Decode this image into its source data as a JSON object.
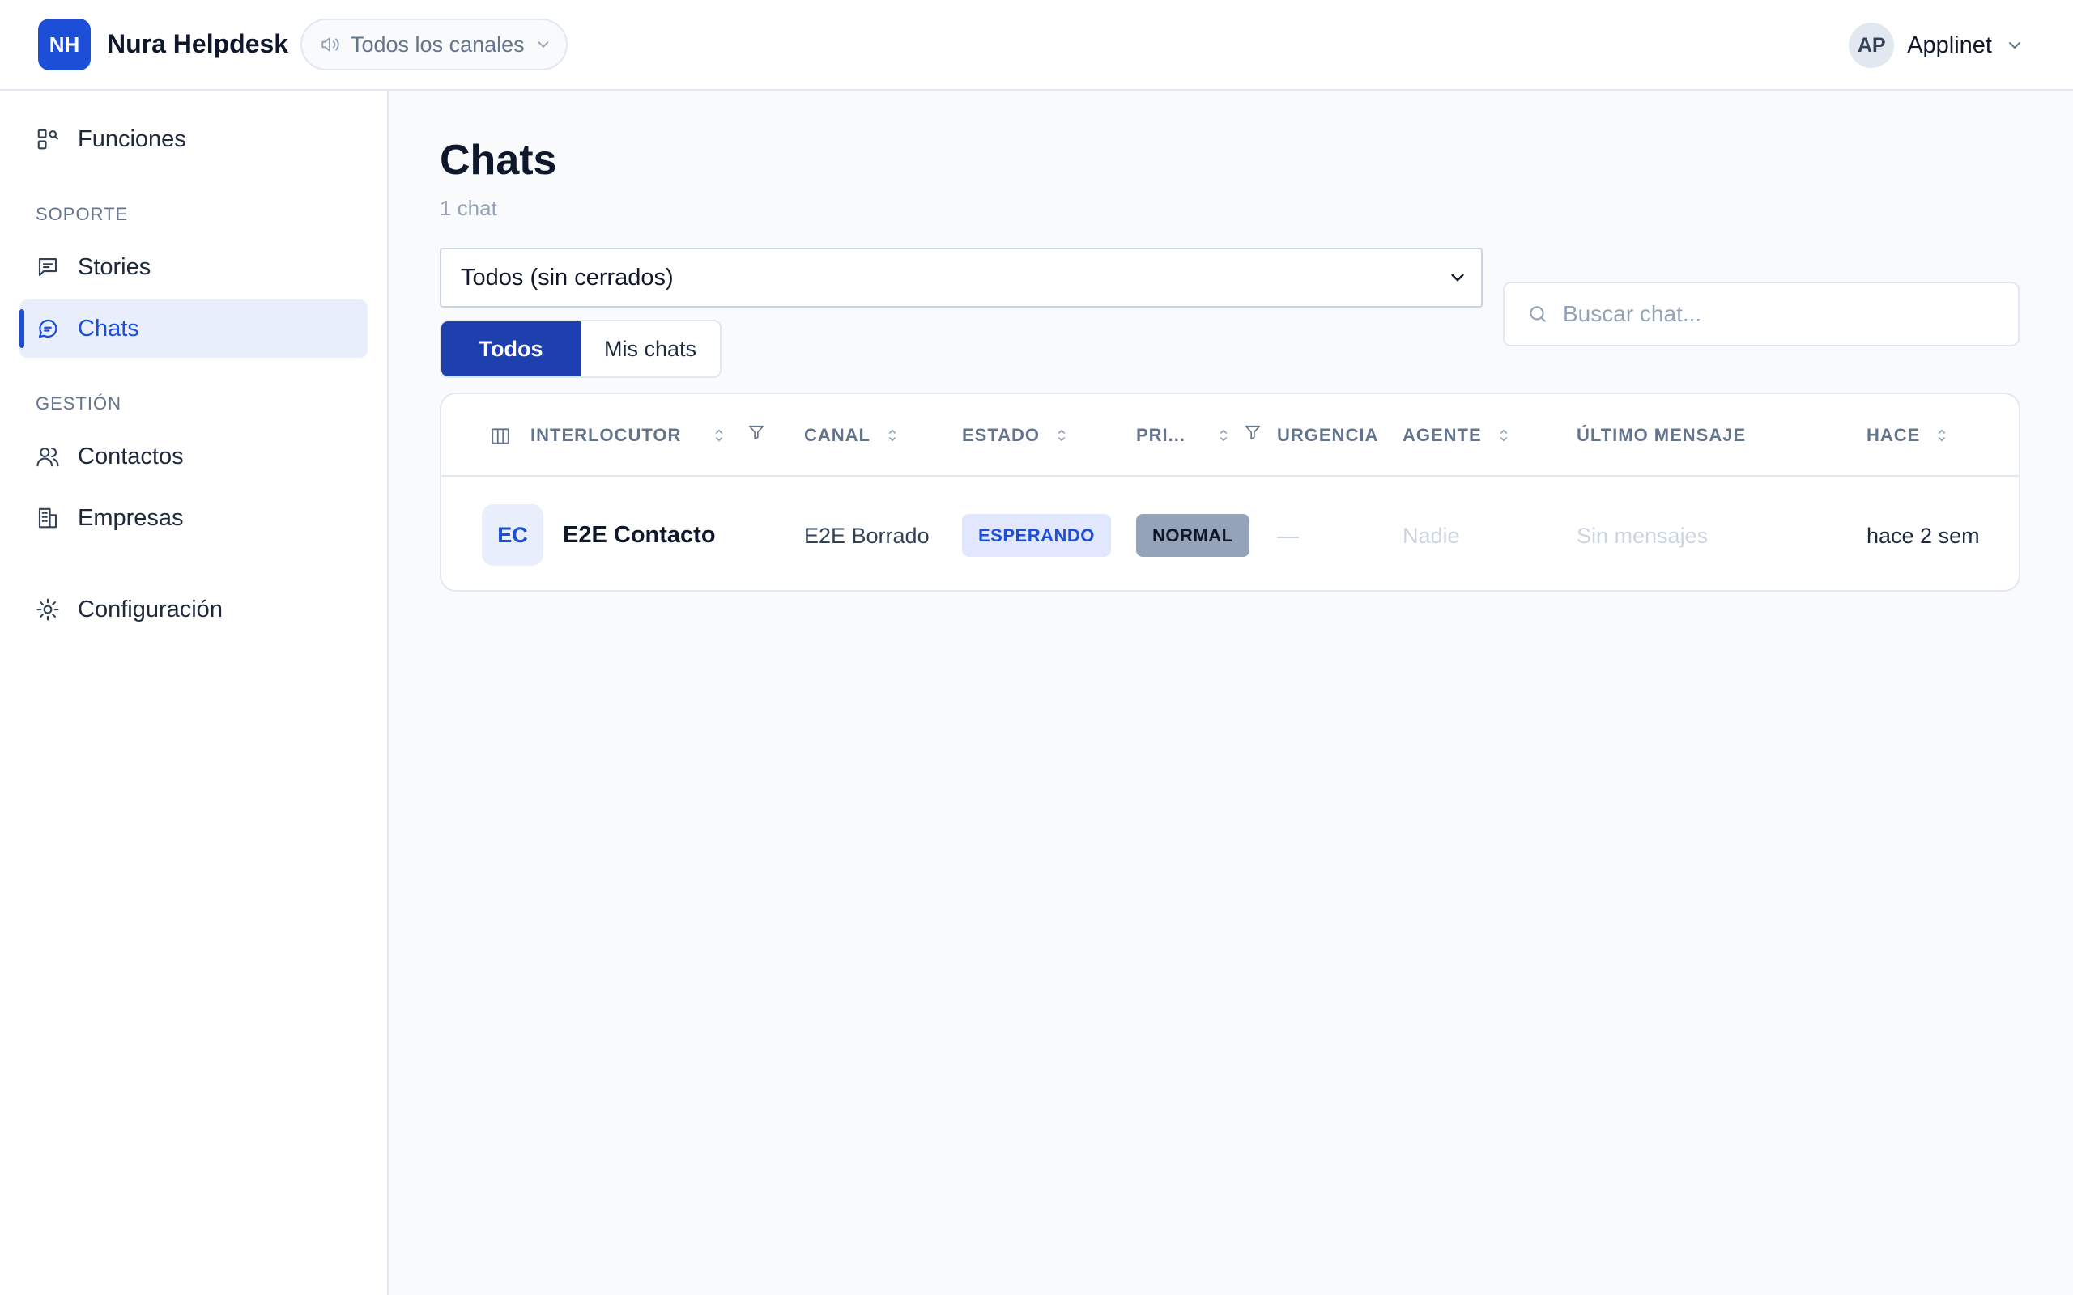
{
  "header": {
    "logo_text": "NH",
    "brand": "Nura Helpdesk",
    "channel_filter": "Todos los canales",
    "user_initials": "AP",
    "user_name": "Applinet"
  },
  "sidebar": {
    "top_item": "Funciones",
    "sections": [
      {
        "title": "SOPORTE",
        "items": [
          "Stories",
          "Chats"
        ]
      },
      {
        "title": "GESTIÓN",
        "items": [
          "Contactos",
          "Empresas"
        ]
      }
    ],
    "bottom_item": "Configuración",
    "active": "Chats"
  },
  "main": {
    "title": "Chats",
    "count": "1 chat",
    "status_filter": "Todos (sin cerrados)",
    "segments": [
      "Todos",
      "Mis chats"
    ],
    "active_segment": "Todos",
    "search_placeholder": "Buscar chat..."
  },
  "table": {
    "columns": [
      "INTERLOCUTOR",
      "CANAL",
      "ESTADO",
      "PRI...",
      "URGENCIA",
      "AGENTE",
      "ÚLTIMO MENSAJE",
      "HACE"
    ],
    "rows": [
      {
        "initials": "EC",
        "interlocutor": "E2E Contacto",
        "canal": "E2E Borrado",
        "estado": "ESPERANDO",
        "prioridad": "NORMAL",
        "urgencia": "—",
        "agente": "Nadie",
        "ultimo_mensaje": "Sin mensajes",
        "hace": "hace 2 sem"
      }
    ]
  },
  "colors": {
    "accent": "#1d4ed8",
    "segment_active": "#1e40af",
    "badge_waiting_bg": "#e0e7ff",
    "badge_normal_bg": "#94a3b8"
  }
}
